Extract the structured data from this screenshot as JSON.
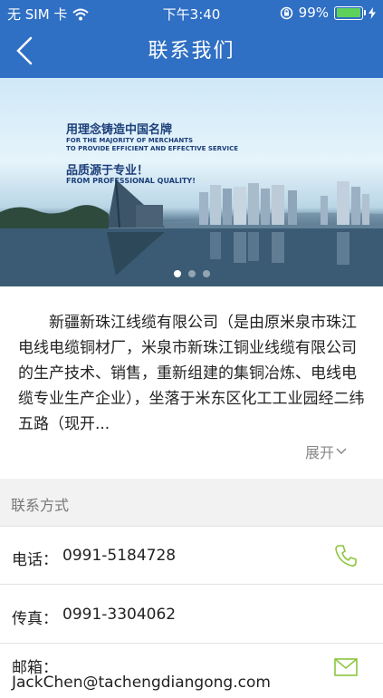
{
  "status_bar": {
    "carrier": "无 SIM 卡",
    "time": "下午3:40",
    "battery_percent": "99%",
    "battery_level": 0.99
  },
  "nav": {
    "title": "联系我们"
  },
  "banner": {
    "headline": "用理念铸造中国名牌",
    "sub_line1": "FOR THE MAJORITY OF MERCHANTS",
    "sub_line2": "TO PROVIDE EFFICIENT AND EFFECTIVE SERVICE",
    "quality": "品质源于专业！",
    "quality_en": "FROM PROFESSIONAL QUALITY!",
    "page_count": 3,
    "active_page": 1
  },
  "intro": {
    "text": "新疆新珠江线缆有限公司（是由原米泉市珠江电线电缆铜材厂，米泉市新珠江铜业线缆有限公司的生产技术、销售，重新组建的集铜冶炼、电线电缆专业生产企业），坐落于米东区化工工业园经二纬五路（现开...",
    "expand_label": "展开"
  },
  "contact": {
    "section_title": "联系方式",
    "phone_label": "电话：",
    "phone_value": "0991-5184728",
    "fax_label": "传真：",
    "fax_value": "0991-3304062",
    "email_label": "邮箱：",
    "email_value": "JackChen@tachengdiangong.com"
  },
  "colors": {
    "nav_bar": "#2f6fc4",
    "icon_green": "#8cc63f"
  }
}
